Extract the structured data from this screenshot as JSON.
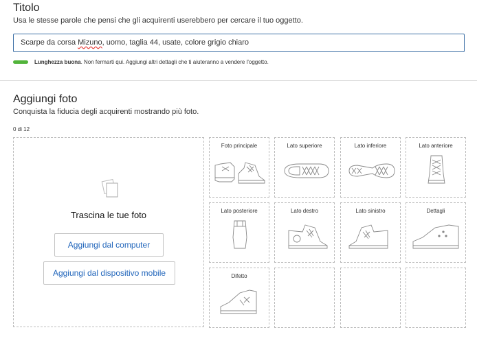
{
  "titolo": {
    "heading": "Titolo",
    "description": "Usa le stesse parole che pensi che gli acquirenti userebbero per cercare il tuo oggetto.",
    "input_prefix": "Scarpe da corsa ",
    "input_misspelled": "Mizuno",
    "input_suffix": ", uomo, taglia 44, usate, colore grigio chiaro",
    "strength_label": "Lunghezza buona",
    "strength_hint": ". Non fermarti qui. Aggiungi altri dettagli che ti aiuteranno a vendere l'oggetto.",
    "strength_progress": 0.15,
    "progress_color": "#52b43b"
  },
  "foto": {
    "heading": "Aggiungi foto",
    "description": "Conquista la fiducia degli acquirenti mostrando più foto.",
    "count_text": "0 di 12",
    "drop_text": "Trascina le tue foto",
    "button_computer": "Aggiungi dal computer",
    "button_mobile": "Aggiungi dal dispositivo mobile",
    "accent_color": "#2266bb",
    "tiles": [
      {
        "label": "Foto principale",
        "icon": "shoe-main-icon"
      },
      {
        "label": "Lato superiore",
        "icon": "shoe-top-icon"
      },
      {
        "label": "Lato inferiore",
        "icon": "shoe-sole-icon"
      },
      {
        "label": "Lato anteriore",
        "icon": "shoe-front-icon"
      },
      {
        "label": "Lato posteriore",
        "icon": "shoe-back-icon"
      },
      {
        "label": "Lato destro",
        "icon": "shoe-right-icon"
      },
      {
        "label": "Lato sinistro",
        "icon": "shoe-left-icon"
      },
      {
        "label": "Dettagli",
        "icon": "shoe-details-icon"
      },
      {
        "label": "Difetto",
        "icon": "shoe-defect-icon"
      },
      {
        "label": "",
        "icon": ""
      },
      {
        "label": "",
        "icon": ""
      },
      {
        "label": "",
        "icon": ""
      }
    ]
  }
}
